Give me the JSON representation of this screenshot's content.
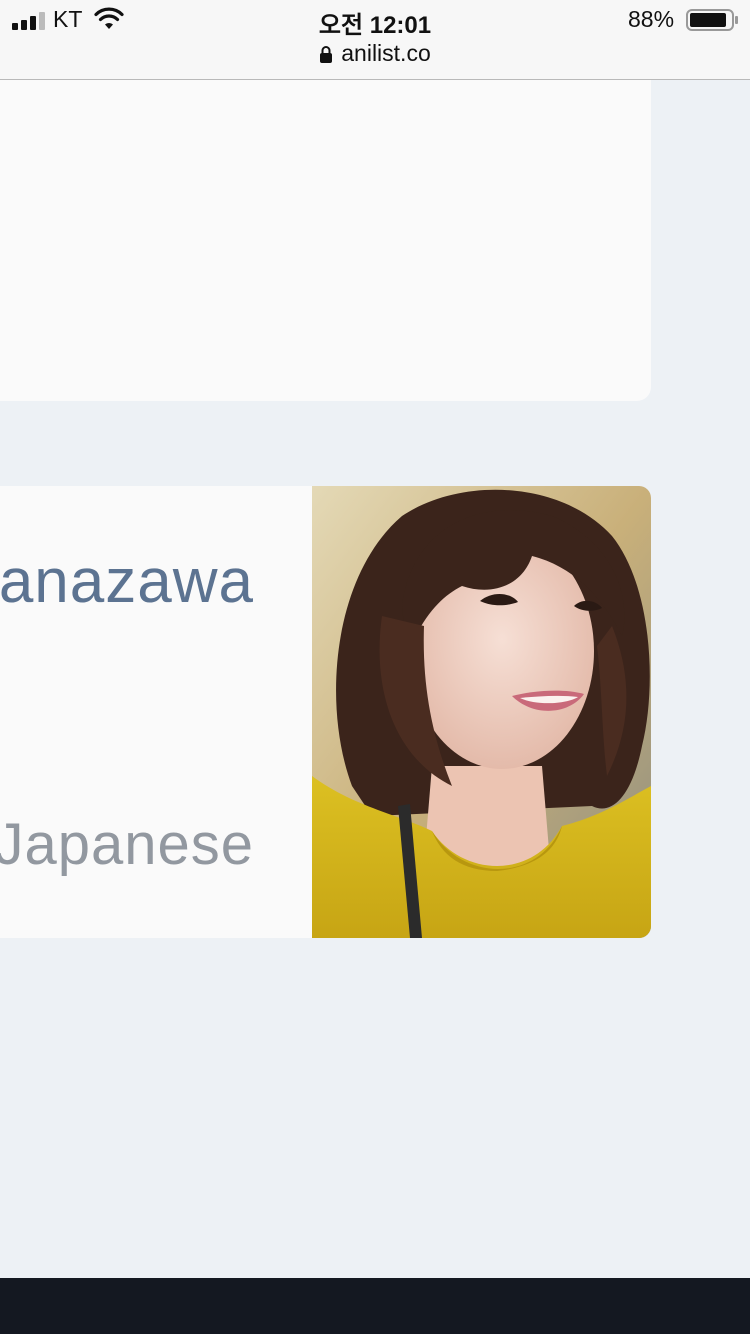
{
  "status_bar": {
    "carrier": "KT",
    "time": "오전 12:01",
    "url": "anilist.co",
    "battery": "88%",
    "icons": [
      "signal-icon",
      "wifi-icon",
      "lock-icon",
      "battery-icon"
    ]
  },
  "staff_card": {
    "name": "anazawa",
    "language": "Japanese",
    "image": "portrait-photo"
  },
  "colors": {
    "page_bg": "#edf1f5",
    "card_bg": "#fafafa",
    "name_text": "#5c7391",
    "language_text": "#9298a0",
    "bottom_nav_bg": "#141821"
  }
}
